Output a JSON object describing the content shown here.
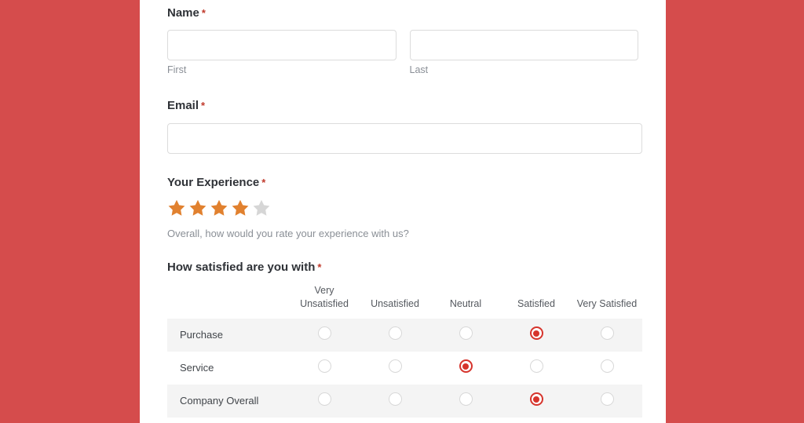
{
  "theme": {
    "page_background": "#d54c4c",
    "panel_background": "#ffffff",
    "required_marker_color": "#c0392b",
    "star_filled_color": "#e1812f",
    "star_empty_color": "#d6d6d6",
    "radio_selected_color": "#d6342c",
    "stripe_color": "#f4f4f4"
  },
  "form": {
    "name": {
      "label": "Name",
      "required_marker": "*",
      "first": {
        "value": "",
        "placeholder": "",
        "sub_label": "First"
      },
      "last": {
        "value": "",
        "placeholder": "",
        "sub_label": "Last"
      }
    },
    "email": {
      "label": "Email",
      "required_marker": "*",
      "value": "",
      "placeholder": ""
    },
    "experience": {
      "label": "Your Experience",
      "required_marker": "*",
      "help_text": "Overall, how would you rate your experience with us?",
      "rating": 4,
      "max_rating": 5,
      "star_icon": "star-icon"
    },
    "satisfaction": {
      "label": "How satisfied are you with",
      "required_marker": "*",
      "columns": [
        "Very Unsatisfied",
        "Unsatisfied",
        "Neutral",
        "Satisfied",
        "Very Satisfied"
      ],
      "rows": [
        {
          "label": "Purchase",
          "selected_index": 3
        },
        {
          "label": "Service",
          "selected_index": 2
        },
        {
          "label": "Company Overall",
          "selected_index": 3
        }
      ]
    }
  }
}
